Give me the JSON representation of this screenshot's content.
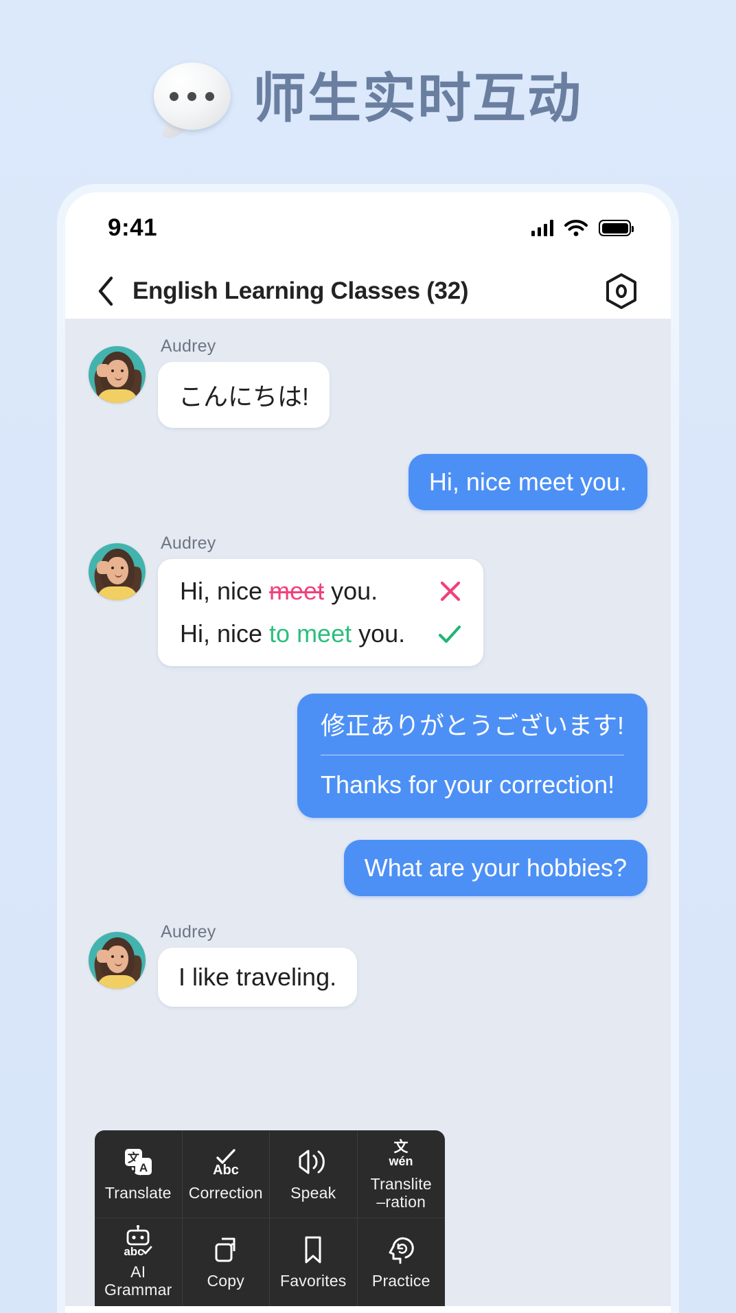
{
  "hero": {
    "title": "师生实时互动",
    "bubble_icon": "speech-bubble-dots-icon",
    "title_color": "#6a7fa0"
  },
  "status_bar": {
    "time": "9:41",
    "signal_icon": "cellular-signal-icon",
    "wifi_icon": "wifi-icon",
    "battery_icon": "battery-full-icon"
  },
  "nav": {
    "back_icon": "chevron-left-icon",
    "title": "English Learning Classes (32)",
    "settings_icon": "hexagon-settings-icon"
  },
  "chat": {
    "messages": [
      {
        "id": "msg-1",
        "side": "left",
        "sender": "Audrey",
        "text": "こんにちは!"
      },
      {
        "id": "msg-2",
        "side": "right",
        "text": "Hi, nice meet you."
      },
      {
        "id": "msg-3",
        "side": "left",
        "sender": "Audrey",
        "type": "correction",
        "wrong_prefix": "Hi, nice ",
        "wrong_word": "meet",
        "wrong_suffix": " you.",
        "wrong_mark": "✕",
        "right_prefix": "Hi, nice ",
        "right_word": "to meet",
        "right_suffix": " you.",
        "right_mark": "✓",
        "wrong_color": "#f0417b",
        "right_color": "#2bbf7e"
      },
      {
        "id": "msg-4",
        "side": "right",
        "type": "dual",
        "primary": "修正ありがとうございます!",
        "secondary": "Thanks for your correction!"
      },
      {
        "id": "msg-5",
        "side": "right",
        "text": "What are your hobbies?"
      },
      {
        "id": "msg-6",
        "side": "left",
        "sender": "Audrey",
        "text": "I like traveling."
      }
    ],
    "bubble_out_color": "#4d90f5",
    "background_color": "#e4e9f2"
  },
  "context_menu": {
    "items": [
      {
        "label": "Translate",
        "icon": "translate-icon"
      },
      {
        "label": "Correction",
        "icon": "check-abc-icon"
      },
      {
        "label": "Speak",
        "icon": "speaker-icon"
      },
      {
        "label": "Translite\n–ration",
        "icon": "wen-transliteration-icon"
      },
      {
        "label": "AI Grammar",
        "icon": "robot-abc-check-icon"
      },
      {
        "label": "Copy",
        "icon": "copy-icon"
      },
      {
        "label": "Favorites",
        "icon": "bookmark-icon"
      },
      {
        "label": "Practice",
        "icon": "head-refresh-icon"
      }
    ],
    "background_color": "#2b2b2b"
  }
}
